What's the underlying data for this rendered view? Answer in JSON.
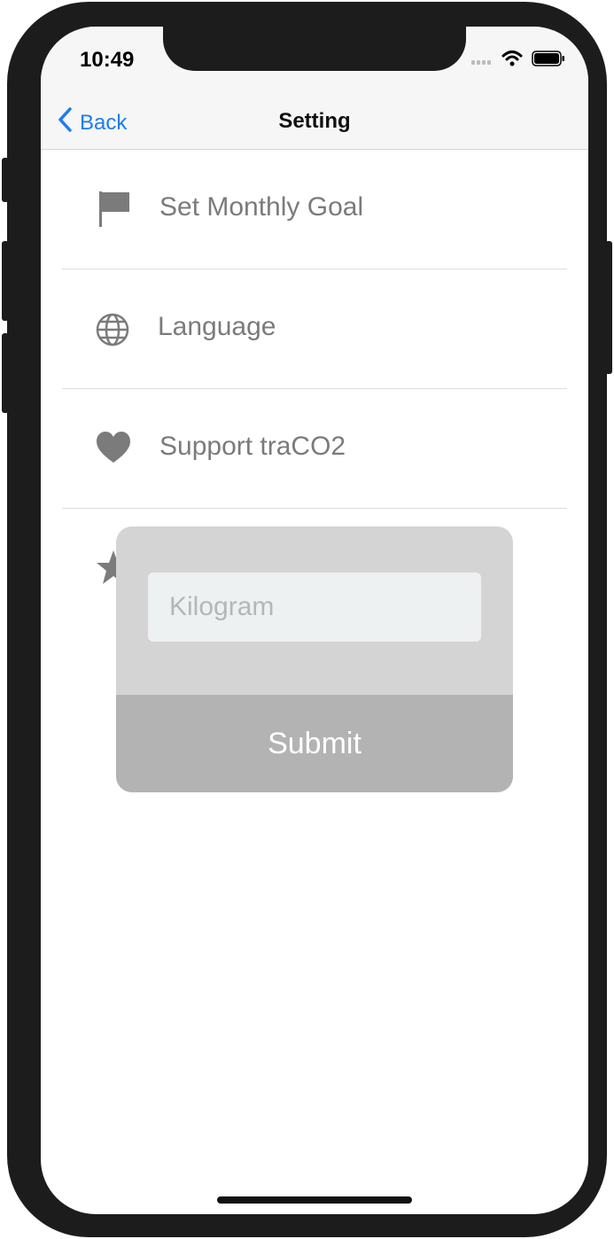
{
  "status_bar": {
    "time": "10:49"
  },
  "nav": {
    "back_label": "Back",
    "title": "Setting"
  },
  "menu": {
    "items": [
      {
        "label": "Set Monthly Goal",
        "icon": "flag-icon"
      },
      {
        "label": "Language",
        "icon": "globe-icon"
      },
      {
        "label": "Support traCO2",
        "icon": "heart-icon"
      },
      {
        "label": "",
        "icon": "star-icon"
      }
    ]
  },
  "dialog": {
    "input_placeholder": "Kilogram",
    "input_value": "",
    "submit_label": "Submit"
  },
  "colors": {
    "accent": "#1a7cf2",
    "icon_gray": "#7b7b7b",
    "dialog_bg": "#d4d4d4",
    "submit_bg": "#b3b3b3"
  }
}
